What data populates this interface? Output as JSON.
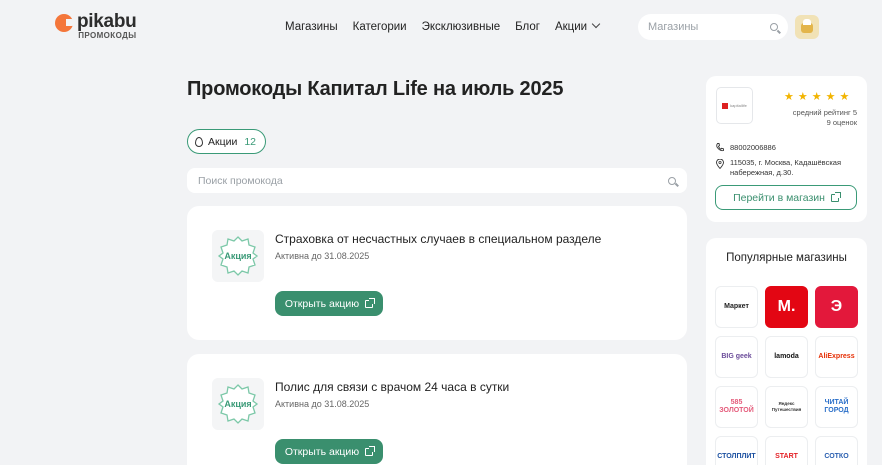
{
  "header": {
    "logo_word": "pikabu",
    "logo_sub": "ПРОМОКОДЫ",
    "nav": [
      "Магазины",
      "Категории",
      "Эксклюзивные",
      "Блог",
      "Акции"
    ],
    "search_placeholder": "Магазины"
  },
  "main": {
    "title": "Промокоды Капитал Life на июль 2025",
    "filter": {
      "label": "Акции",
      "count": "12"
    },
    "search_placeholder": "Поиск промокода",
    "offers": [
      {
        "badge": "Акция",
        "title": "Страховка от несчастных случаев в специальном разделе",
        "date": "Активна до 31.08.2025",
        "button": "Открыть акцию"
      },
      {
        "badge": "Акция",
        "title": "Полис для связи с врачом 24 часа в сутки",
        "date": "Активна до 31.08.2025",
        "button": "Открыть акцию"
      }
    ]
  },
  "store": {
    "logo_text": "kapitallife",
    "rating_stars": 5,
    "rating_label": "средний рейтинг 5",
    "rating_count": "9 оценок",
    "phone": "88002006886",
    "address": "115035, г. Москва, Кадашёвская набережная, д.30.",
    "button": "Перейти в магазин"
  },
  "popular": {
    "title": "Популярные магазины",
    "stores": [
      {
        "name": "Яндекс Маркет",
        "text": "Маркет",
        "bg": "#ffffff",
        "fg": "#222222"
      },
      {
        "name": "М.Видео",
        "text": "М.",
        "bg": "#e30613",
        "fg": "#ffffff"
      },
      {
        "name": "Мегамаркет",
        "text": "Э",
        "bg": "#e3183b",
        "fg": "#ffffff"
      },
      {
        "name": "BIG GEEK",
        "text": "BIG geek",
        "bg": "#ffffff",
        "fg": "#6b4c9a"
      },
      {
        "name": "Lamoda",
        "text": "lamoda",
        "bg": "#ffffff",
        "fg": "#111111"
      },
      {
        "name": "AliExpress",
        "text": "AliExpress",
        "bg": "#ffffff",
        "fg": "#e62e04"
      },
      {
        "name": "Золото",
        "text": "585 ЗОЛОТОЙ",
        "bg": "#ffffff",
        "fg": "#e45a7a"
      },
      {
        "name": "Яндекс Путешествия",
        "text": "Яндекс Путешествия",
        "bg": "#ffffff",
        "fg": "#333333"
      },
      {
        "name": "Читай-город",
        "text": "ЧИТАЙ ГОРОД",
        "bg": "#ffffff",
        "fg": "#2a6fc9"
      },
      {
        "name": "Столплит",
        "text": "СТОЛПЛИТ",
        "bg": "#ffffff",
        "fg": "#1a4fa0"
      },
      {
        "name": "START",
        "text": "START",
        "bg": "#ffffff",
        "fg": "#e31e24"
      },
      {
        "name": "Сотко",
        "text": "СОТКО",
        "bg": "#ffffff",
        "fg": "#2a5fb0"
      }
    ]
  },
  "colors": {
    "accent": "#3a8f6e",
    "star": "#f2b400",
    "background": "#f2f3f5"
  }
}
